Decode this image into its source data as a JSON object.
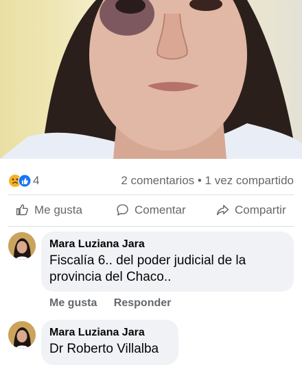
{
  "post": {
    "reaction_count": "4",
    "meta": "2 comentarios • 1 vez compartido",
    "reaction_icons": [
      "sad-face-icon",
      "like-thumb-icon"
    ]
  },
  "actions": {
    "like_label": "Me gusta",
    "comment_label": "Comentar",
    "share_label": "Compartir"
  },
  "comments": [
    {
      "author": "Mara Luziana Jara",
      "lines": [
        "Fiscalía 6.. del poder judicial de la",
        "provincia del Chaco.."
      ],
      "like_label": "Me gusta",
      "reply_label": "Responder"
    },
    {
      "author": "Mara Luziana Jara",
      "lines": [
        "Dr Roberto Villalba"
      ]
    }
  ],
  "colors": {
    "secondary_text": "#65676b",
    "bubble_bg": "#f0f2f5",
    "like_blue": "#1877f2",
    "sad_yellow": "#f7b125"
  }
}
